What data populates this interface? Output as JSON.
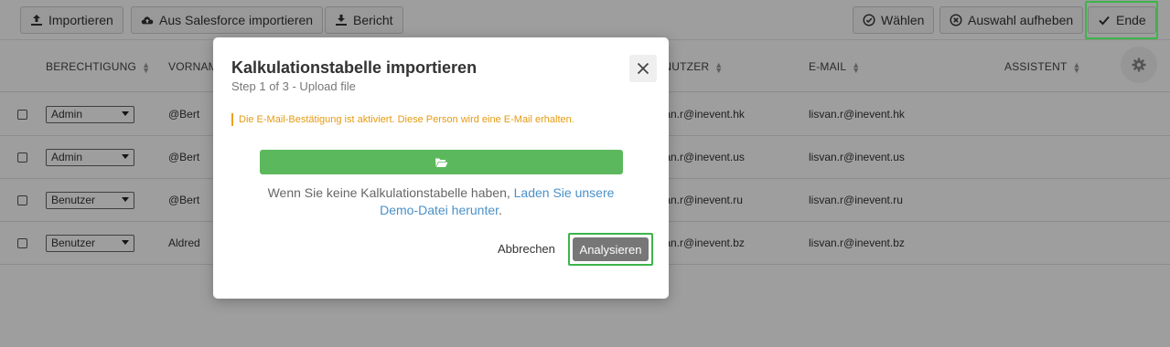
{
  "toolbar": {
    "import_label": "Importieren",
    "salesforce_label": "Aus Salesforce importieren",
    "report_label": "Bericht",
    "select_label": "Wählen",
    "deselect_label": "Auswahl aufheben",
    "done_label": "Ende"
  },
  "table": {
    "columns": [
      "BERECHTIGUNG",
      "VORNAME",
      "BENUTZER",
      "E-MAIL",
      "ASSISTENT"
    ],
    "rows": [
      {
        "permission": "Admin",
        "name": "@Bert",
        "user": "lisvan.r@inevent.hk",
        "email": "lisvan.r@inevent.hk"
      },
      {
        "permission": "Admin",
        "name": "@Bert",
        "user": "lisvan.r@inevent.us",
        "email": "lisvan.r@inevent.us"
      },
      {
        "permission": "Benutzer",
        "name": "@Bert",
        "user": "lisvan.r@inevent.ru",
        "email": "lisvan.r@inevent.ru"
      },
      {
        "permission": "Benutzer",
        "name": "Aldred",
        "user": "lisvan.r@inevent.bz",
        "email": "lisvan.r@inevent.bz"
      }
    ]
  },
  "modal": {
    "title": "Kalkulationstabelle importieren",
    "step": "Step 1 of 3 - Upload file",
    "warning": "Die E-Mail-Bestätigung ist aktiviert. Diese Person wird eine E-Mail erhalten.",
    "info_text": "Wenn Sie keine Kalkulationstabelle haben, ",
    "info_link": "Laden Sie unsere Demo-Datei herunter",
    "info_end": ".",
    "cancel_label": "Abbrechen",
    "analyze_label": "Analysieren"
  },
  "colors": {
    "highlight": "#3cb54a",
    "upload_button": "#5cb85c",
    "warning": "#e69a12",
    "link": "#4a90c8"
  },
  "icons": [
    "upload-icon",
    "cloud-upload-icon",
    "download-icon",
    "check-circle-icon",
    "x-circle-icon",
    "check-icon",
    "sort-icon",
    "gear-icon",
    "close-icon",
    "folder-open-icon"
  ]
}
